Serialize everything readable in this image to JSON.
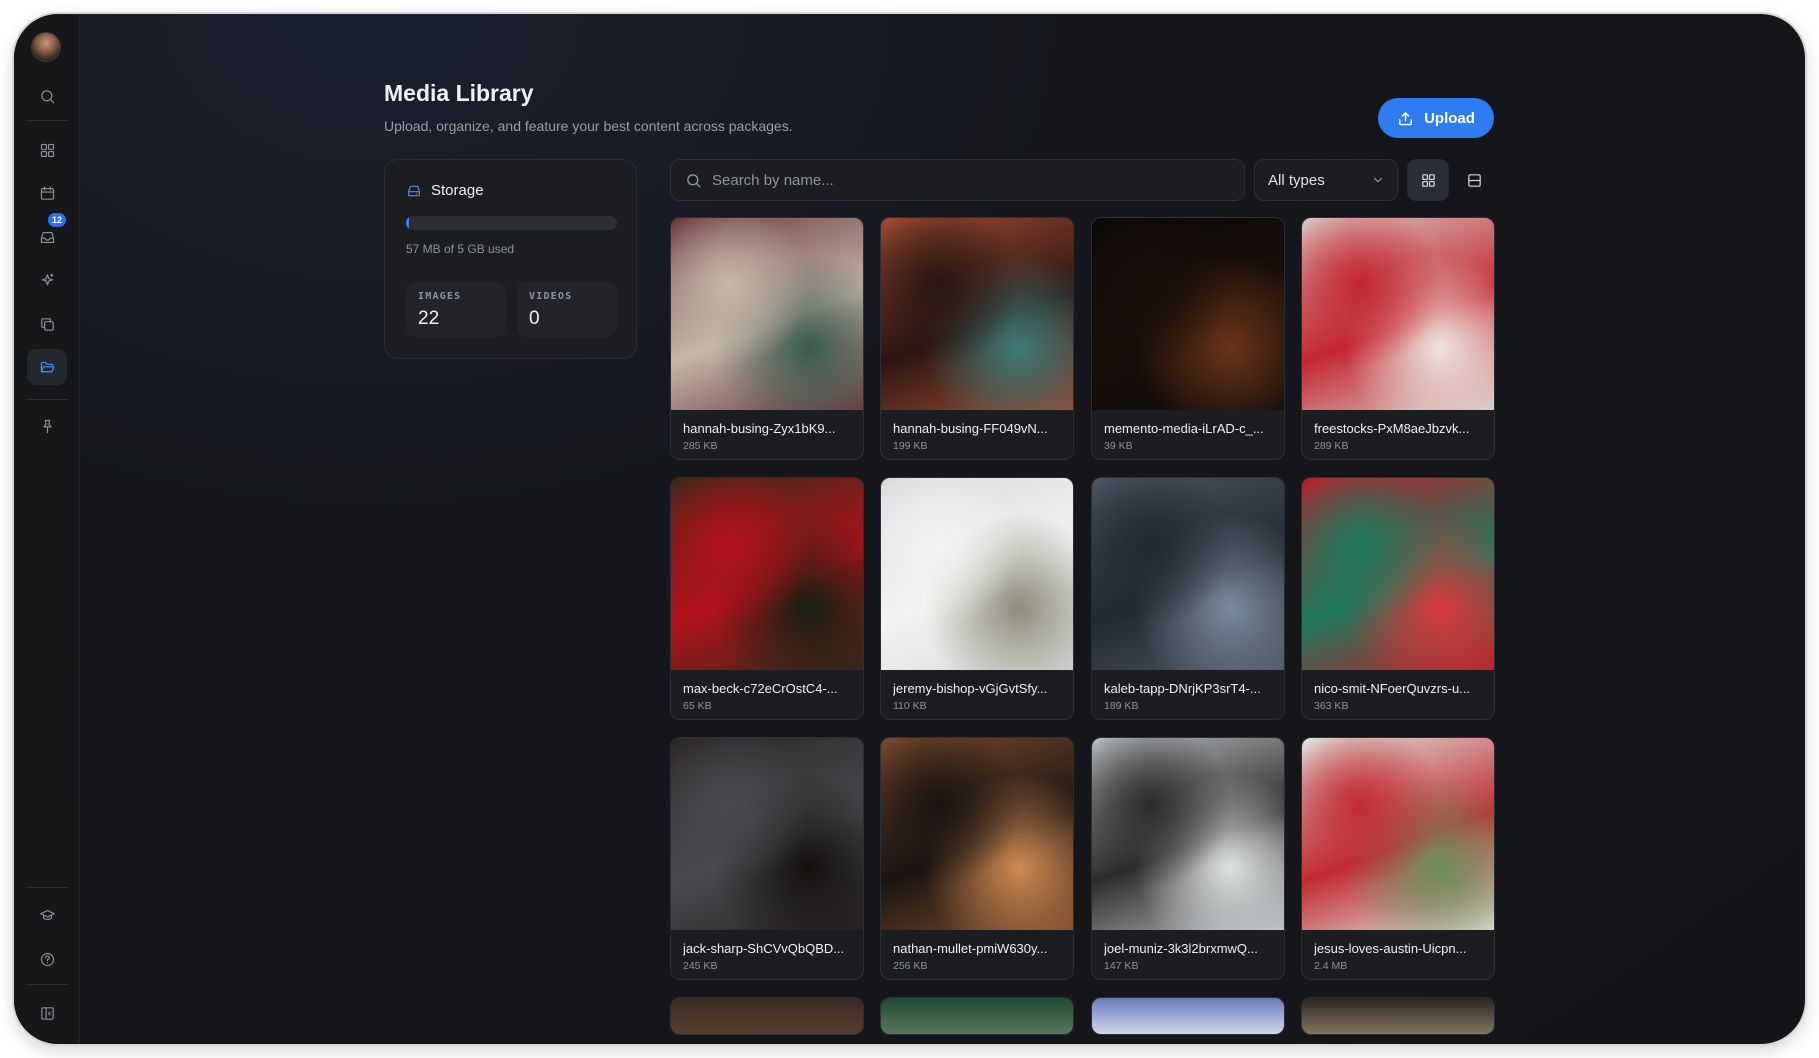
{
  "page": {
    "title": "Media Library",
    "subtitle": "Upload, organize, and feature your best content across packages.",
    "upload_label": "Upload"
  },
  "sidebar": {
    "items": [
      {
        "name": "search",
        "icon": "search-icon"
      },
      {
        "name": "dashboard",
        "icon": "dashboard-icon"
      },
      {
        "name": "calendar",
        "icon": "calendar-icon"
      },
      {
        "name": "inbox",
        "icon": "inbox-icon",
        "badge": "12"
      },
      {
        "name": "sparkles",
        "icon": "sparkles-icon"
      },
      {
        "name": "copy",
        "icon": "copy-icon"
      },
      {
        "name": "media",
        "icon": "folder-icon",
        "active": true
      },
      {
        "name": "pin",
        "icon": "pin-icon"
      },
      {
        "name": "learn",
        "icon": "graduation-cap-icon"
      },
      {
        "name": "help",
        "icon": "help-icon"
      },
      {
        "name": "collapse",
        "icon": "sidebar-toggle-icon"
      }
    ]
  },
  "storage": {
    "title": "Storage",
    "used_text": "57 MB of 5 GB used",
    "used_fraction": 0.011,
    "images_label": "IMAGES",
    "images_count": "22",
    "videos_label": "VIDEOS",
    "videos_count": "0"
  },
  "toolbar": {
    "search_placeholder": "Search by name...",
    "filter_value": "All types",
    "view_modes": [
      "grid-view-icon",
      "list-view-icon"
    ],
    "active_view": "grid"
  },
  "media": [
    {
      "name": "hannah-busing-Zyx1bK9...",
      "size": "285 KB",
      "colors": [
        "#6b3a3f",
        "#c7b7a8",
        "#3a5a4e"
      ]
    },
    {
      "name": "hannah-busing-FF049vN...",
      "size": "199 KB",
      "colors": [
        "#a14a32",
        "#2a1612",
        "#3e7b78"
      ]
    },
    {
      "name": "memento-media-iLrAD-c_...",
      "size": "39 KB",
      "colors": [
        "#0b0a0a",
        "#1a0e0a",
        "#6a3418"
      ]
    },
    {
      "name": "freestocks-PxM8aeJbzvk...",
      "size": "289 KB",
      "colors": [
        "#d9c7c2",
        "#c42631",
        "#eee5df"
      ]
    },
    {
      "name": "max-beck-c72eCrOstC4-...",
      "size": "65 KB",
      "colors": [
        "#3a2a1a",
        "#b3121b",
        "#172012"
      ]
    },
    {
      "name": "jeremy-bishop-vGjGvtSfy...",
      "size": "110 KB",
      "colors": [
        "#d9dbdb",
        "#f3f3f2",
        "#8e8c7a"
      ]
    },
    {
      "name": "kaleb-tapp-DNrjKP3srT4-...",
      "size": "189 KB",
      "colors": [
        "#4c5563",
        "#222830",
        "#7a8aa0"
      ]
    },
    {
      "name": "nico-smit-NFoerQuvzrs-u...",
      "size": "363 KB",
      "colors": [
        "#b81f2b",
        "#1e7a5e",
        "#d93a3a"
      ]
    },
    {
      "name": "jack-sharp-ShCVvQbQBD...",
      "size": "245 KB",
      "colors": [
        "#2b2626",
        "#4a4a4f",
        "#14110f"
      ]
    },
    {
      "name": "nathan-mullet-pmiW630y...",
      "size": "256 KB",
      "colors": [
        "#7a4a2c",
        "#1a1412",
        "#d08a52"
      ]
    },
    {
      "name": "joel-muniz-3k3l2brxmwQ...",
      "size": "147 KB",
      "colors": [
        "#b7bcc0",
        "#2e2c2b",
        "#dfe2e3"
      ]
    },
    {
      "name": "jesus-loves-austin-Uicpn...",
      "size": "2.4 MB",
      "colors": [
        "#dfe7e0",
        "#c22a32",
        "#6b8f5a"
      ]
    }
  ],
  "media_partial": [
    {
      "colors": [
        "#3a2a22",
        "#5a4030"
      ]
    },
    {
      "colors": [
        "#1f4a34",
        "#5a7a5a"
      ]
    },
    {
      "colors": [
        "#6a7ab8",
        "#d6ddf2"
      ]
    },
    {
      "colors": [
        "#2a2420",
        "#8a7a60"
      ]
    }
  ]
}
